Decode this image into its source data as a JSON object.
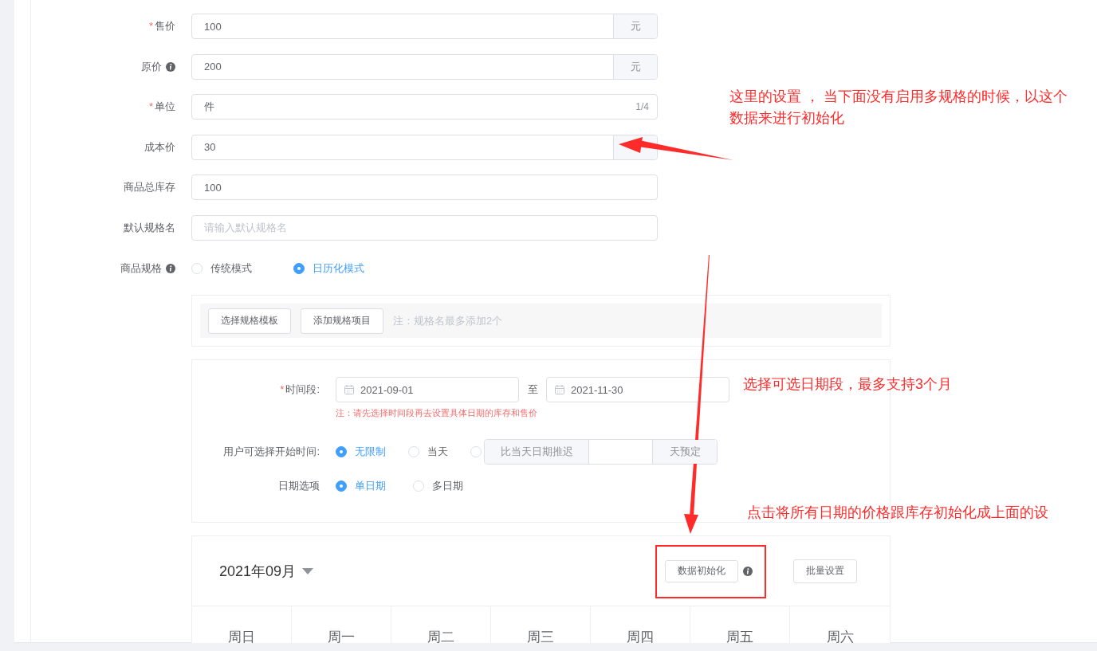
{
  "fields": [
    {
      "label": "售价",
      "required_mark": "*",
      "info": false,
      "value": "100",
      "suffix": "元"
    },
    {
      "label": "原价",
      "info": true,
      "value": "200",
      "suffix": "元"
    },
    {
      "label": "单位",
      "required_mark": "*",
      "info": false,
      "value": "件",
      "counter": "1/4"
    },
    {
      "label": "成本价",
      "info": false,
      "value": "30",
      "addon": true
    },
    {
      "label": "商品总库存",
      "info": false,
      "value": "100"
    },
    {
      "label": "默认规格名",
      "info": false,
      "placeholder": "请输入默认规格名"
    }
  ],
  "spec_mode": {
    "label": "商品规格",
    "info": true,
    "options": [
      {
        "label": "传统模式",
        "selected": false
      },
      {
        "label": "日历化模式",
        "selected": true
      }
    ]
  },
  "spec_toolbar": {
    "buttons": [
      "选择规格模板",
      "添加规格项目"
    ],
    "note": "注：规格名最多添加2个"
  },
  "date_settings": {
    "period": {
      "required_mark": "*",
      "label": "时间段:",
      "start": "2021-09-01",
      "separator": "至",
      "end": "2021-11-30",
      "note": "注：请先选择时间段再去设置具体日期的库存和售价"
    },
    "start_time": {
      "label": "用户可选择开始时间:",
      "options": [
        {
          "kind": "text",
          "label": "无限制",
          "selected": true
        },
        {
          "kind": "text",
          "label": "当天",
          "selected": false
        },
        {
          "kind": "delay",
          "selected": false,
          "prefix": "比当天日期推迟",
          "suffix": "天预定"
        }
      ]
    },
    "date_option": {
      "label": "日期选项",
      "options": [
        {
          "kind": "text",
          "label": "单日期",
          "selected": true
        },
        {
          "kind": "text",
          "label": "多日期",
          "selected": false
        }
      ]
    }
  },
  "calendar": {
    "month": "2021年09月",
    "init_button": "数据初始化",
    "batch_button": "批量设置",
    "weekdays": [
      "周日",
      "周一",
      "周二",
      "周三",
      "周四",
      "周五",
      "周六"
    ]
  },
  "annotations": [
    {
      "text": "这里的设置 ， 当下面没有启用多规格的时候，以这个数据来进行初始化"
    },
    {
      "text": "选择可选日期段，最多支持3个月"
    },
    {
      "text": "点击将所有日期的价格跟库存初始化成上面的设"
    }
  ]
}
